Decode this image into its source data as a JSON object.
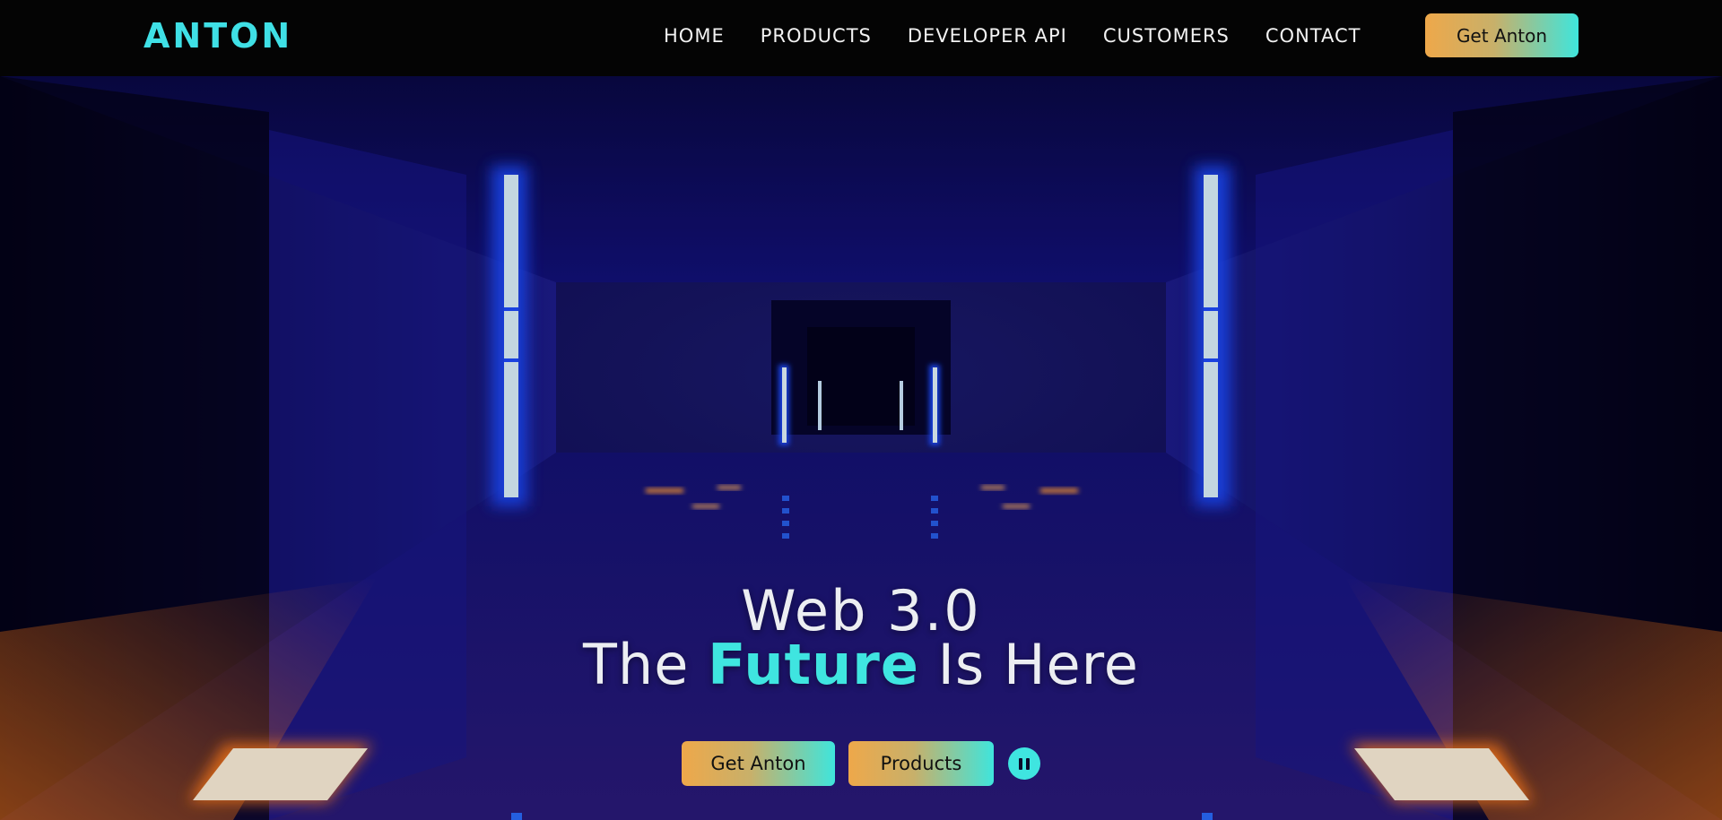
{
  "brand": {
    "logo": "ANTON"
  },
  "nav": {
    "links": [
      "HOME",
      "PRODUCTS",
      "DEVELOPER API",
      "CUSTOMERS",
      "CONTACT"
    ],
    "cta_label": "Get Anton"
  },
  "hero": {
    "headline_line1": "Web 3.0",
    "headline_line2_prefix": "The ",
    "headline_line2_accent": "Future",
    "headline_line2_suffix": " Is Here",
    "primary_button": "Get Anton",
    "secondary_button": "Products",
    "video_control_icon": "pause-icon"
  },
  "colors": {
    "accent": "#3fe5e0",
    "button_gradient_start": "#eea84a",
    "button_gradient_end": "#3fe5dc",
    "navbar_bg": "#040404",
    "corridor_blue": "#1c1a9c",
    "light_orange": "#ff8a2a"
  }
}
